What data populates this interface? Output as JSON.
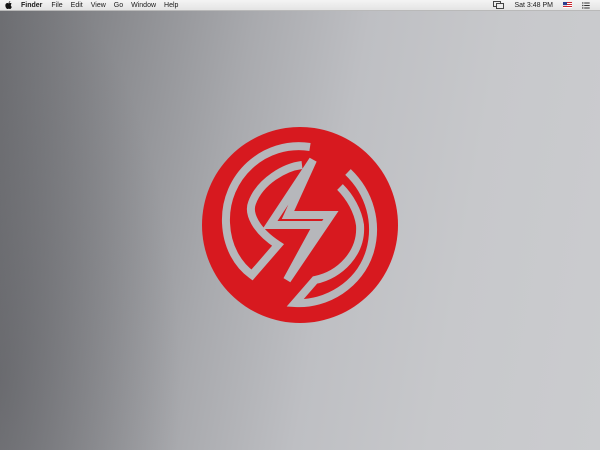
{
  "menubar": {
    "app_name": "Finder",
    "menus": [
      "File",
      "Edit",
      "View",
      "Go",
      "Window",
      "Help"
    ],
    "clock": "Sat 3:48 PM"
  },
  "icons": {
    "apple": "apple-icon",
    "display_mirroring": "screen-mirroring-icon",
    "input_source": "us-flag-icon",
    "notification_center": "notification-center-icon"
  },
  "colors": {
    "logo_red": "#d7191f",
    "logo_stroke": "#b6b7bb"
  }
}
